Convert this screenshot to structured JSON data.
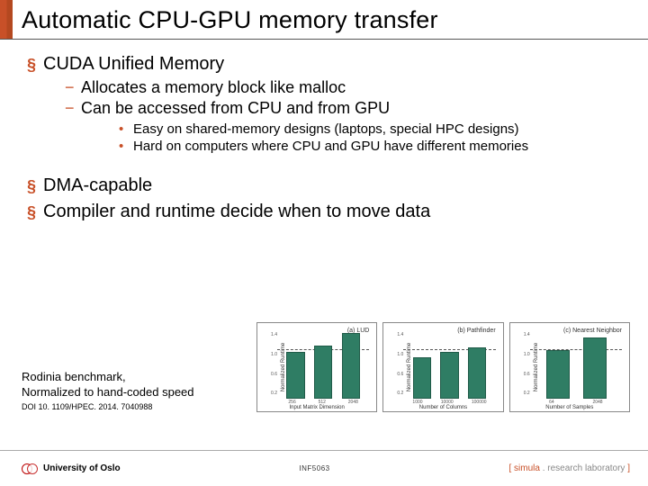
{
  "title": "Automatic CPU-GPU memory transfer",
  "b1": {
    "item1": "CUDA Unified Memory",
    "sub1": "Allocates a memory block like malloc",
    "sub2": "Can be accessed from CPU and from GPU",
    "dot1": "Easy on shared-memory designs (laptops, special HPC designs)",
    "dot2": "Hard on computers where CPU and GPU have different memories"
  },
  "b2": {
    "item1": "DMA-capable",
    "item2": "Compiler and runtime decide when to move data"
  },
  "caption": {
    "line1": "Rodinia benchmark,",
    "line2": "Normalized to hand-coded speed",
    "doi": "DOI 10. 1109/HPEC. 2014. 7040988"
  },
  "chart_data": [
    {
      "type": "bar",
      "title": "(a) LUD",
      "xlabel": "Input Matrix Dimension",
      "ylabel": "Normalized Runtime",
      "ylim": [
        0,
        1.4
      ],
      "yticks": [
        0.2,
        0.4,
        0.6,
        0.8,
        1.0,
        1.2,
        1.4
      ],
      "categories": [
        "256",
        "512",
        "2048"
      ],
      "values": [
        0.95,
        1.1,
        1.35
      ]
    },
    {
      "type": "bar",
      "title": "(b) Pathfinder",
      "xlabel": "Number of Columns",
      "ylabel": "Normalized Runtime",
      "ylim": [
        0,
        1.4
      ],
      "yticks": [
        0.2,
        0.4,
        0.6,
        0.8,
        1.0,
        1.2,
        1.4
      ],
      "categories": [
        "1000",
        "10000",
        "100000"
      ],
      "values": [
        0.85,
        0.95,
        1.05
      ]
    },
    {
      "type": "bar",
      "title": "(c) Nearest Neighbor",
      "xlabel": "Number of Samples",
      "ylabel": "Normalized Runtime",
      "ylim": [
        0,
        1.4
      ],
      "yticks": [
        0.2,
        0.4,
        0.6,
        0.8,
        1.0,
        1.2,
        1.4
      ],
      "categories": [
        "64",
        "2048"
      ],
      "values": [
        1.0,
        1.25
      ]
    }
  ],
  "footer": {
    "left": "University of Oslo",
    "center": "INF5063",
    "simula_bracket_l": "[ ",
    "simula_name": "simula",
    "simula_dot": " . ",
    "simula_rest": "research laboratory",
    "simula_bracket_r": " ]"
  }
}
